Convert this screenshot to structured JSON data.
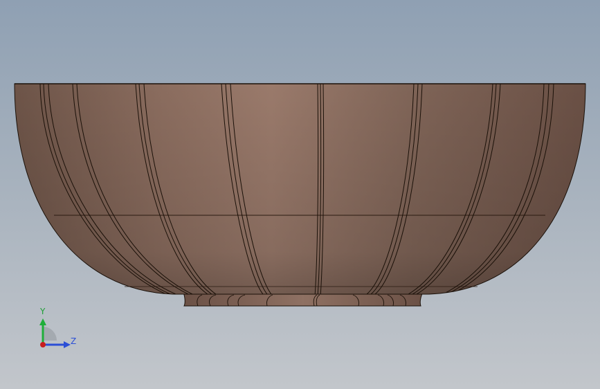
{
  "viewport": {
    "model_name": "bowl",
    "colors": {
      "background_top": "#8fa0b3",
      "background_bottom": "#c2c6cb",
      "model_body": "#8a6f62",
      "model_highlight": "#a08070",
      "edge_line": "#1a1008"
    }
  },
  "triad": {
    "y_label": "Y",
    "z_label": "Z",
    "colors": {
      "y_axis": "#1fae3a",
      "z_axis": "#2b4fd6",
      "x_axis": "#c81e1e",
      "y_label_color": "#1f9f36",
      "z_label_color": "#2b4fd6"
    }
  }
}
